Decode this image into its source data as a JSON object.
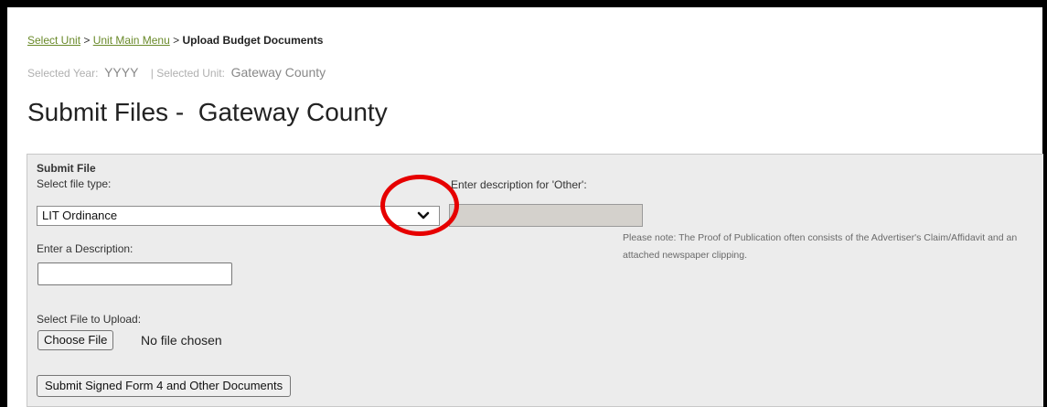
{
  "breadcrumb": {
    "select_unit": "Select Unit",
    "sep1": " > ",
    "unit_main_menu": "Unit Main Menu",
    "sep2": " > ",
    "current": "Upload Budget Documents"
  },
  "meta": {
    "year_label": "Selected Year:",
    "year_value": "YYYY",
    "unit_label": "| Selected Unit:",
    "unit_value": "Gateway County"
  },
  "page_title": "Submit Files -  Gateway County",
  "form": {
    "section_title": "Submit File",
    "file_type_label": "Select file type:",
    "file_type_selected": "LIT Ordinance",
    "other_desc_label": "Enter description for 'Other':",
    "other_desc_value": "",
    "note": "Please note: The Proof of Publication often consists of the Advertiser's Claim/Affidavit and an attached newspaper clipping.",
    "description_label": "Enter a Description:",
    "description_value": "",
    "file_label": "Select File to Upload:",
    "choose_file_button": "Choose File",
    "no_file_text": "No file chosen",
    "submit_button": "Submit Signed Form 4 and Other Documents"
  },
  "colors": {
    "link": "#6a8a2a",
    "annotation_circle": "#e60000",
    "panel_bg": "#ececec"
  },
  "icons": {
    "dropdown": "chevron-down-icon"
  }
}
